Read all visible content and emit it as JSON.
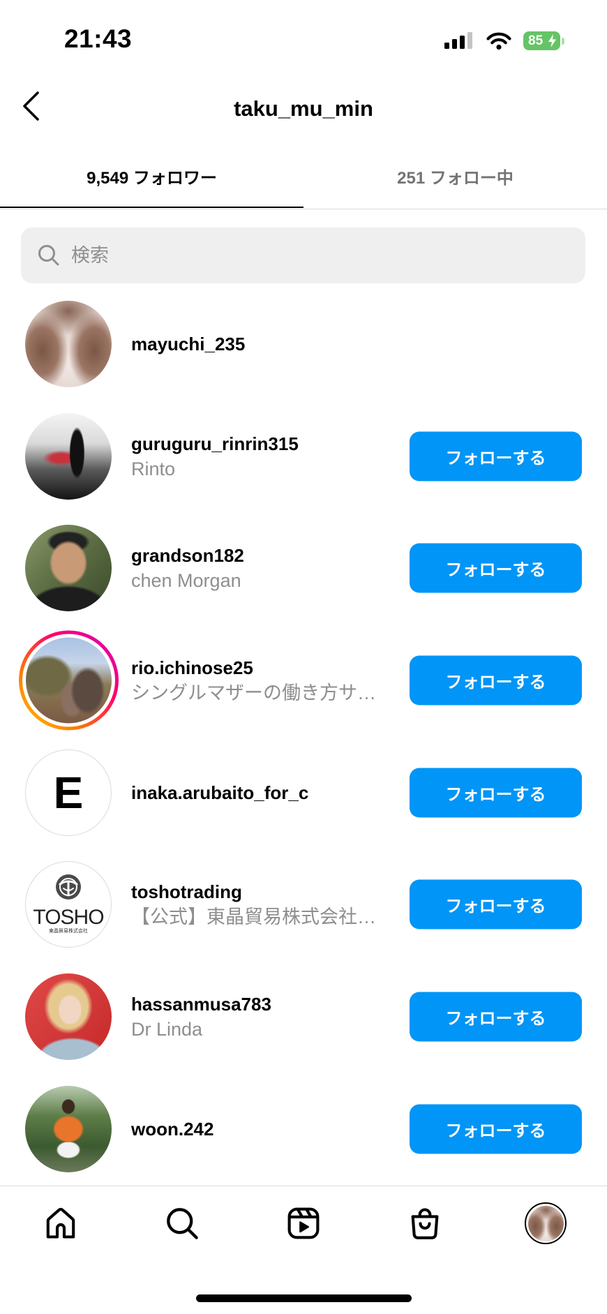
{
  "status_bar": {
    "time": "21:43",
    "battery_level": "85",
    "icons": [
      "cellular-signal-icon",
      "wifi-icon",
      "battery-charging-icon"
    ]
  },
  "header": {
    "title": "taku_mu_min",
    "back_icon": "chevron-left-icon"
  },
  "tabs": [
    {
      "label": "9,549 フォロワー",
      "active": true
    },
    {
      "label": "251 フォロー中",
      "active": false
    }
  ],
  "search": {
    "placeholder": "検索",
    "icon": "search-icon"
  },
  "followers": [
    {
      "username": "mayuchi_235",
      "has_story": false
    },
    {
      "username": "guruguru_rinrin315",
      "name": "Rinto",
      "follow_label": "フォローする",
      "has_story": false
    },
    {
      "username": "grandson182",
      "name": "chen Morgan",
      "follow_label": "フォローする",
      "has_story": false
    },
    {
      "username": "rio.ichinose25",
      "name": "シングルマザーの働き方サ…",
      "follow_label": "フォローする",
      "has_story": true
    },
    {
      "username": "inaka.arubaito_for_c",
      "follow_label": "フォローする",
      "has_story": false,
      "avatar_letter": "E"
    },
    {
      "username": "toshotrading",
      "name": "【公式】東晶貿易株式会社…",
      "follow_label": "フォローする",
      "has_story": false,
      "avatar_logo_text": "TOSHO",
      "avatar_logo_subtext": "東晶貿易株式会社"
    },
    {
      "username": "hassanmusa783",
      "name": "Dr Linda",
      "follow_label": "フォローする",
      "has_story": false
    },
    {
      "username": "woon.242",
      "follow_label": "フォローする",
      "has_story": false
    }
  ],
  "bottom_nav": [
    {
      "icon": "home-icon",
      "active": false
    },
    {
      "icon": "search-icon",
      "active": false
    },
    {
      "icon": "reels-icon",
      "active": false
    },
    {
      "icon": "shop-icon",
      "active": false
    },
    {
      "icon": "profile-avatar",
      "active": true
    }
  ],
  "colors": {
    "accent": "#0095f6",
    "text_primary": "#000000",
    "text_secondary": "#8e8e8e",
    "search_background": "#efefef",
    "divider": "#dbdbdb",
    "battery": "#65c466",
    "story_ring_start": "#ffc800",
    "story_ring_end": "#d300c5"
  }
}
